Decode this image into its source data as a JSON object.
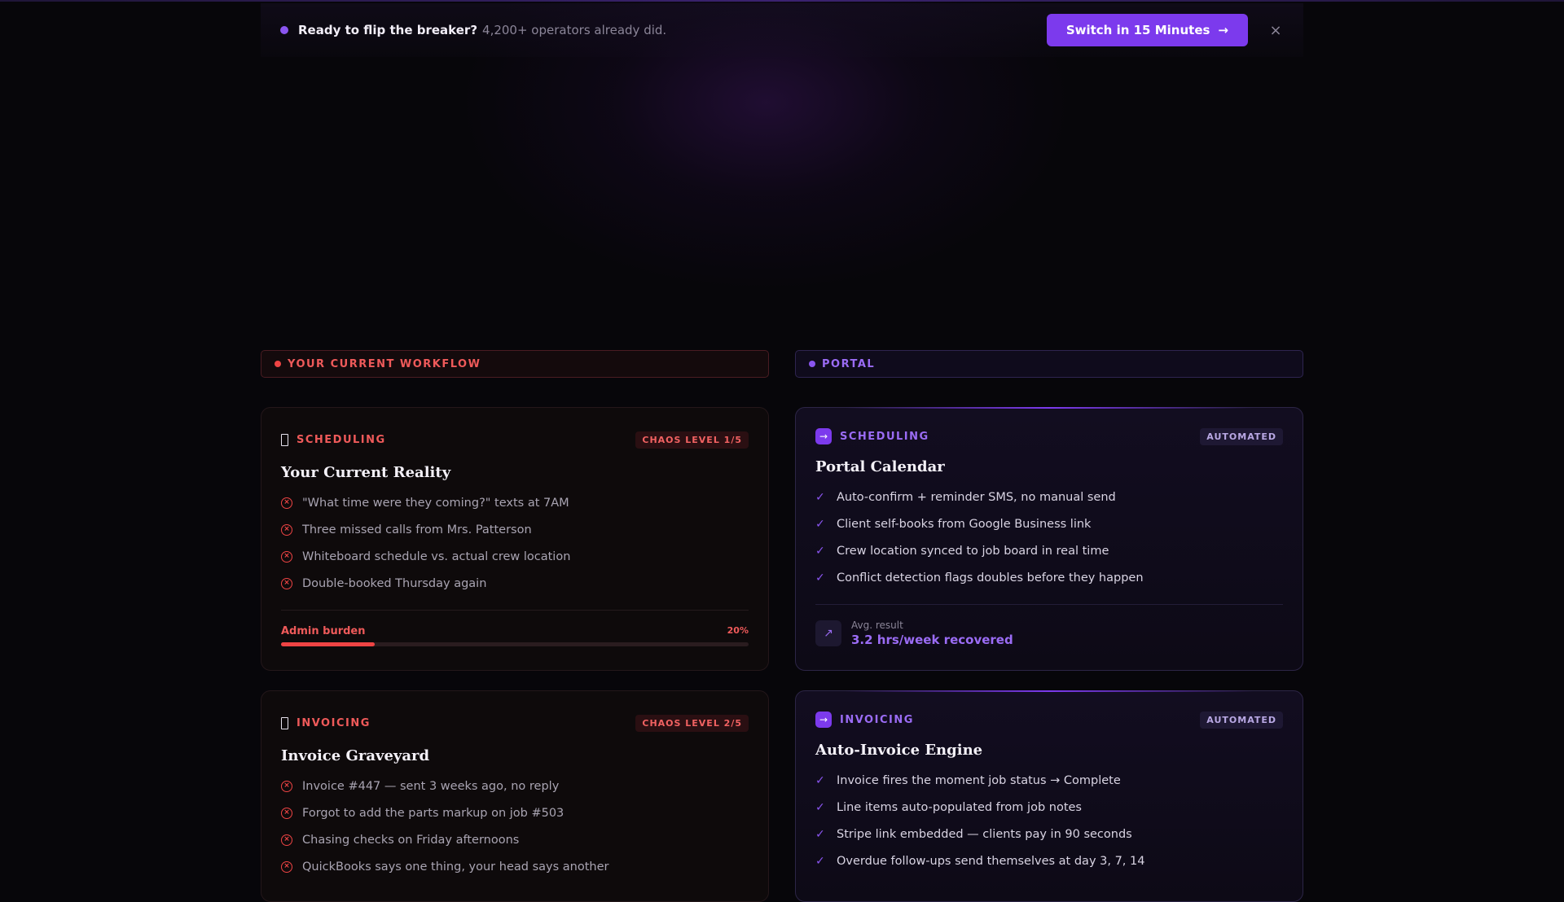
{
  "banner": {
    "lead": "Ready to flip the breaker?",
    "sub": "4,200+ operators already did.",
    "cta_label": "Switch in 15 Minutes",
    "cta_arrow": "→",
    "close_glyph": "×"
  },
  "columns": {
    "left_label": "YOUR CURRENT WORKFLOW",
    "right_label": "PORTAL"
  },
  "bad_cards": [
    {
      "category": "SCHEDULING",
      "badge": "CHAOS LEVEL 1/5",
      "title": "Your Current Reality",
      "items": [
        "\"What time were they coming?\" texts at 7AM",
        "Three missed calls from Mrs. Patterson",
        "Whiteboard schedule vs. actual crew location",
        "Double-booked Thursday again"
      ],
      "meter_label": "Admin burden",
      "meter_value": "20%",
      "meter_fraction": 0.2
    },
    {
      "category": "INVOICING",
      "badge": "CHAOS LEVEL 2/5",
      "title": "Invoice Graveyard",
      "items": [
        "Invoice #447 — sent 3 weeks ago, no reply",
        "Forgot to add the parts markup on job #503",
        "Chasing checks on Friday afternoons",
        "QuickBooks says one thing, your head says another"
      ]
    }
  ],
  "good_cards": [
    {
      "category": "SCHEDULING",
      "badge": "AUTOMATED",
      "title": "Portal Calendar",
      "items": [
        "Auto-confirm + reminder SMS, no manual send",
        "Client self-books from Google Business link",
        "Crew location synced to job board in real time",
        "Conflict detection flags doubles before they happen"
      ],
      "result_label": "Avg. result",
      "result_value": "3.2 hrs/week recovered"
    },
    {
      "category": "INVOICING",
      "badge": "AUTOMATED",
      "title": "Auto-Invoice Engine",
      "items": [
        "Invoice fires the moment job status → Complete",
        "Line items auto-populated from job notes",
        "Stripe link embedded — clients pay in 90 seconds",
        "Overdue follow-ups send themselves at day 3, 7, 14"
      ]
    }
  ],
  "icons": {
    "x": "×",
    "check": "✓",
    "arrow": "→",
    "trend": "↗"
  },
  "colors": {
    "accent": "#7c3aed",
    "danger": "#ef4444",
    "background": "#07060a"
  }
}
